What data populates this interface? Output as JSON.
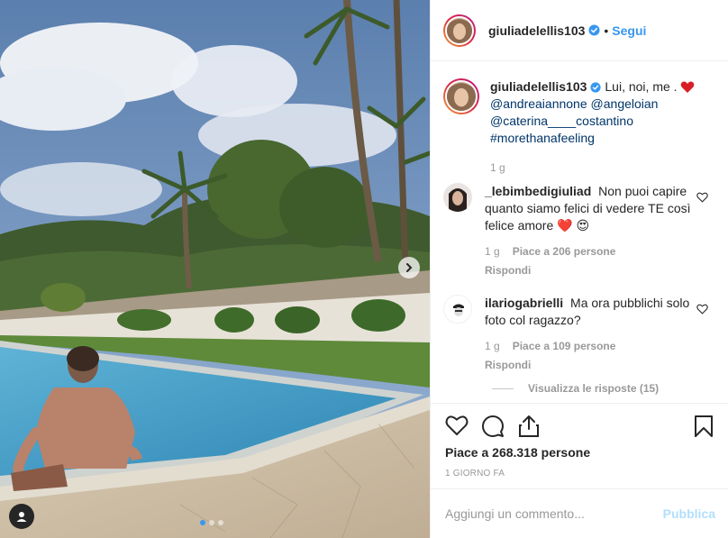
{
  "post": {
    "username": "giuliadelellis103",
    "follow_label": "Segui",
    "dot": "•",
    "caption": {
      "text": "Lui, noi, me . ",
      "mentions": [
        "@andreaiannone",
        "@angeloian",
        "@caterina____costantino"
      ],
      "hashtag": "#morethanafeeling",
      "age": "1 g"
    },
    "image": {
      "carousel_dots": 3,
      "active_dot": 0,
      "next_icon": "chevron-right-icon",
      "tag_icon": "user-tag-icon"
    }
  },
  "comments": [
    {
      "username": "_lebimbedigiuliad",
      "text": "Non puoi capire quanto siamo felici di vedere TE così felice amore",
      "emojis": [
        "❤️",
        "😍"
      ],
      "age": "1 g",
      "likes": "Piace a 206 persone",
      "reply": "Rispondi"
    },
    {
      "username": "ilariogabrielli",
      "text": "Ma ora pubblichi solo foto col ragazzo?",
      "age": "1 g",
      "likes": "Piace a 109 persone",
      "reply": "Rispondi",
      "view_replies": "Visualizza le risposte (15)"
    }
  ],
  "actions": {
    "like_icon": "heart-icon",
    "comment_icon": "comment-icon",
    "share_icon": "share-icon",
    "save_icon": "bookmark-icon",
    "likes_text": "Piace a 268.318 persone",
    "timestamp": "1 GIORNO FA"
  },
  "add_comment": {
    "placeholder": "Aggiungi un commento...",
    "publish_label": "Pubblica"
  },
  "colors": {
    "accent": "#3897f0",
    "text": "#262626",
    "muted": "#999999",
    "link": "#003569",
    "publish_disabled": "#b2dffc",
    "heart_red": "#ed4956"
  }
}
